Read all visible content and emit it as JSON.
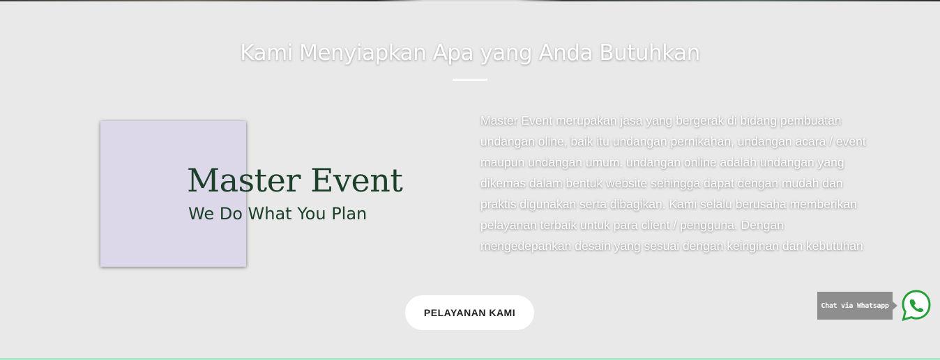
{
  "section": {
    "title": "Kami Menyiapkan Apa yang Anda Butuhkan",
    "description": "Master Event merupakan jasa yang bergerak di bidang pembuatan undangan oline, baik itu undangan pernikahan, undangan acara / event maupun undangan umum. undangan online adalah undangan yang dikemas dalam bentuk website sehingga dapat dengan mudah dan praktis digunakan serta dibagikan. Kami selalu berusaha memberikan pelayanan terbaik untuk para client / pengguna. Dengan mengedepankan desain yang sesuai dengan keinginan dan kebutuhan"
  },
  "logo": {
    "brand": "Master Event",
    "tagline": "We Do What You Plan",
    "brand_color": "#1c4029",
    "box_color": "#dcd8ea"
  },
  "cta": {
    "label": "PELAYANAN KAMI"
  },
  "chat_widget": {
    "label": "Chat via Whatsapp",
    "icon": "whatsapp-icon",
    "icon_color": "#25a038"
  },
  "colors": {
    "background": "#e9e9e9",
    "text": "#ffffff",
    "bottom_accent": "#a9e6c4"
  }
}
